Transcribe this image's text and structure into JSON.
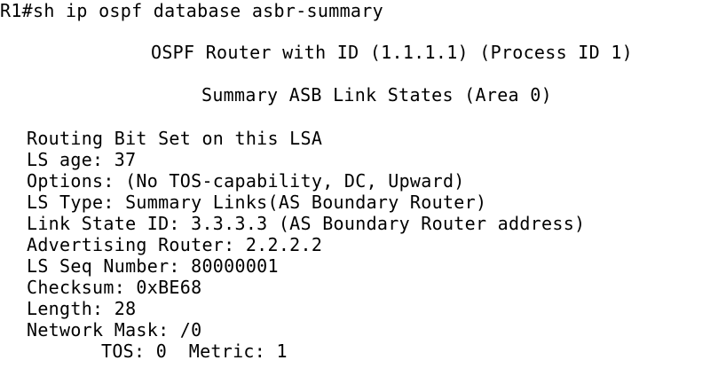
{
  "terminal": {
    "command_line": "R1#sh ip ospf database asbr-summary",
    "router_header": "OSPF Router with ID (1.1.1.1) (Process ID 1)",
    "area_header": "Summary ASB Link States (Area 0)",
    "lsa": {
      "routing_bit": "Routing Bit Set on this LSA",
      "ls_age": "LS age: 37",
      "options": "Options: (No TOS-capability, DC, Upward)",
      "ls_type": "LS Type: Summary Links(AS Boundary Router)",
      "link_state_id": "Link State ID: 3.3.3.3 (AS Boundary Router address)",
      "advertising_router": "Advertising Router: 2.2.2.2",
      "seq_number": "LS Seq Number: 80000001",
      "checksum": "Checksum: 0xBE68",
      "length": "Length: 28",
      "network_mask": "Network Mask: /0",
      "tos_metric": "TOS: 0  Metric: 1"
    }
  }
}
